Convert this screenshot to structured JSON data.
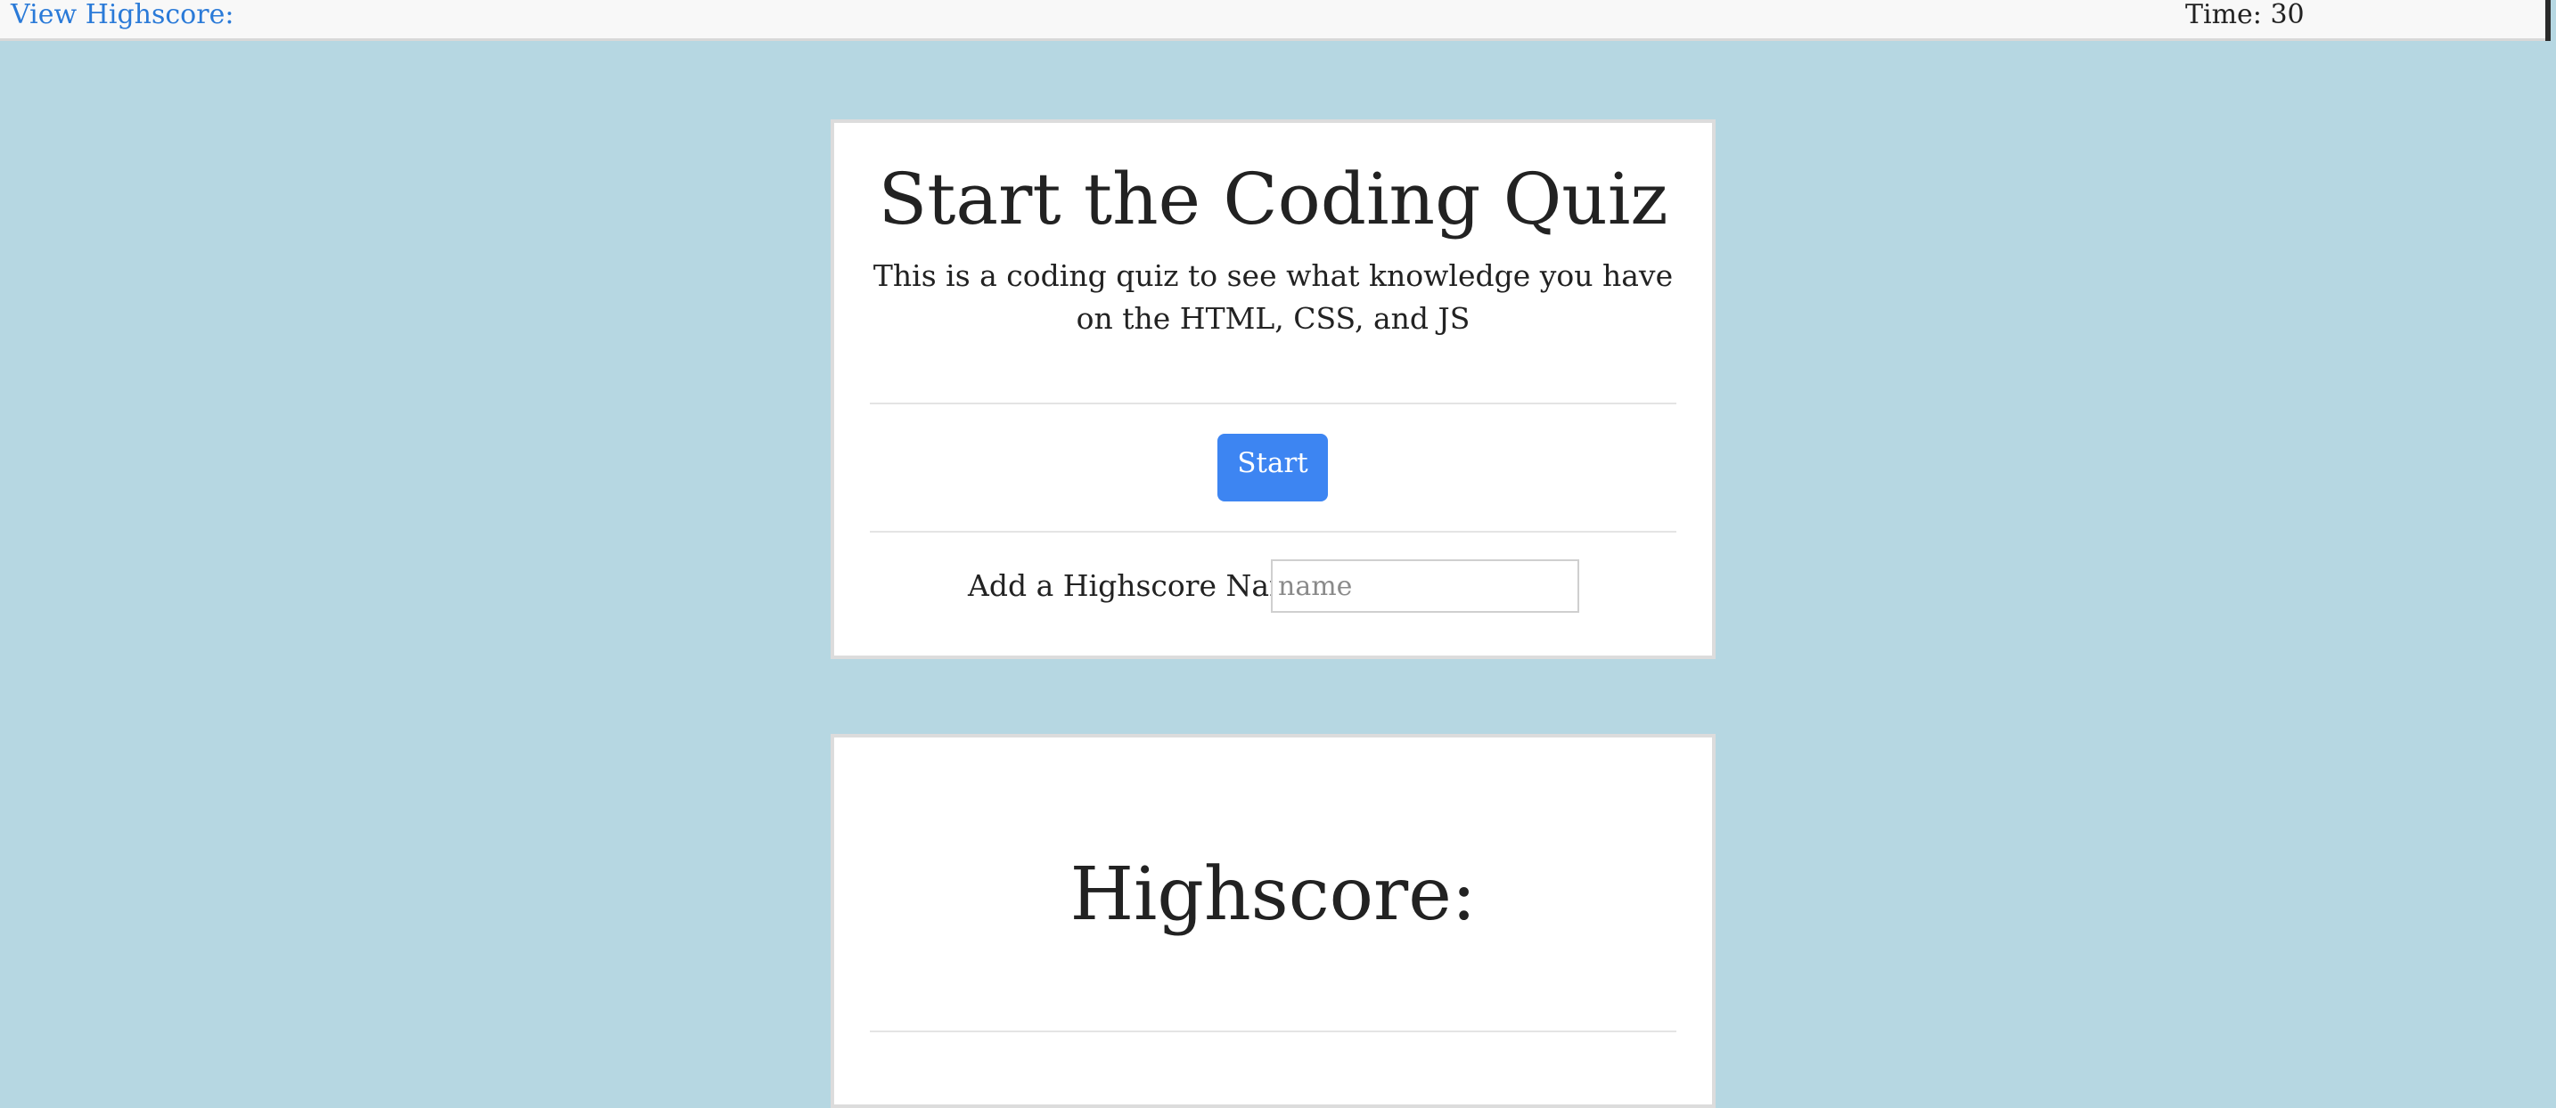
{
  "topbar": {
    "highscore_link": "View Highscore:",
    "timer": "Time: 30"
  },
  "start_card": {
    "title": "Start the Coding Quiz",
    "description": "This is a coding quiz to see what knowledge you have on the HTML, CSS, and JS",
    "start_button": "Start",
    "highscore_label": "Add a Highscore Name:",
    "highscore_placeholder": "name"
  },
  "score_card": {
    "title": "Highscore:"
  },
  "colors": {
    "background": "#b6d7e2",
    "link": "#2a7ad8",
    "button": "#3d85f2"
  }
}
